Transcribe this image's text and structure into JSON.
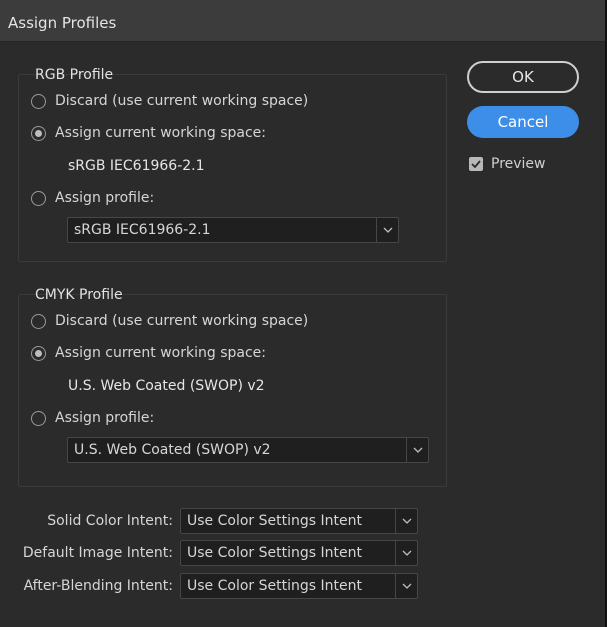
{
  "window": {
    "title": "Assign Profiles"
  },
  "rgb": {
    "group_title": "RGB Profile",
    "discard_label": "Discard (use current working space)",
    "assign_current_label": "Assign current working space:",
    "current_space": "sRGB IEC61966-2.1",
    "assign_profile_label": "Assign profile:",
    "profile_select": "sRGB IEC61966-2.1",
    "selected_option": "assign_current"
  },
  "cmyk": {
    "group_title": "CMYK Profile",
    "discard_label": "Discard (use current working space)",
    "assign_current_label": "Assign current working space:",
    "current_space": "U.S. Web Coated (SWOP) v2",
    "assign_profile_label": "Assign profile:",
    "profile_select": "U.S. Web Coated (SWOP) v2",
    "selected_option": "assign_current"
  },
  "buttons": {
    "ok": "OK",
    "cancel": "Cancel"
  },
  "preview": {
    "label": "Preview",
    "checked": true
  },
  "intents": [
    {
      "label": "Solid Color Intent:",
      "value": "Use Color Settings Intent"
    },
    {
      "label": "Default Image Intent:",
      "value": "Use Color Settings Intent"
    },
    {
      "label": "After-Blending Intent:",
      "value": "Use Color Settings Intent"
    }
  ],
  "colors": {
    "accent": "#3d8ee8",
    "background": "#2b2b2b",
    "titlebar": "#3c3c3c"
  }
}
